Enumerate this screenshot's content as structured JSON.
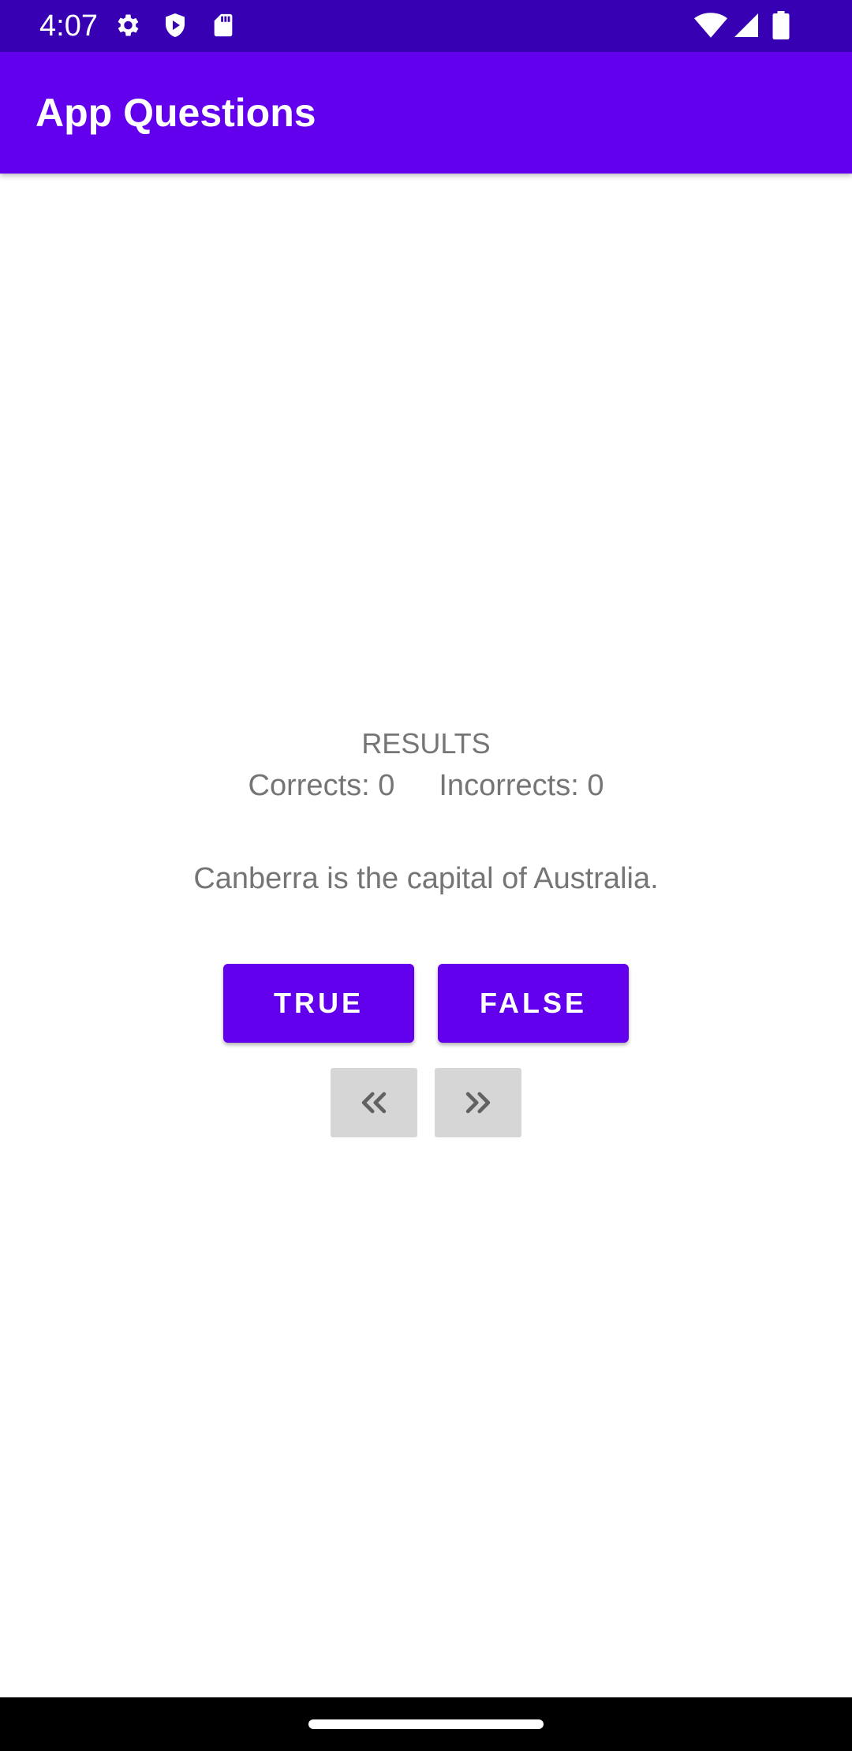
{
  "status_bar": {
    "time": "4:07",
    "left_icons": [
      "settings-gear-icon",
      "play-shield-icon",
      "sd-card-icon"
    ],
    "right_icons": [
      "wifi-icon",
      "cell-signal-icon",
      "battery-icon"
    ]
  },
  "app_bar": {
    "title": "App Questions"
  },
  "results": {
    "title": "RESULTS",
    "corrects_label": "Corrects: 0",
    "incorrects_label": "Incorrects: 0"
  },
  "question": {
    "text": "Canberra is the capital of Australia."
  },
  "buttons": {
    "true_label": "TRUE",
    "false_label": "FALSE",
    "prev_icon": "double-chevron-left-icon",
    "next_icon": "double-chevron-right-icon"
  },
  "colors": {
    "status_bar": "#3700b3",
    "app_bar": "#6200ee",
    "primary_button": "#6200ee",
    "nav_button": "#d6d6d6",
    "body_text": "#757575"
  }
}
